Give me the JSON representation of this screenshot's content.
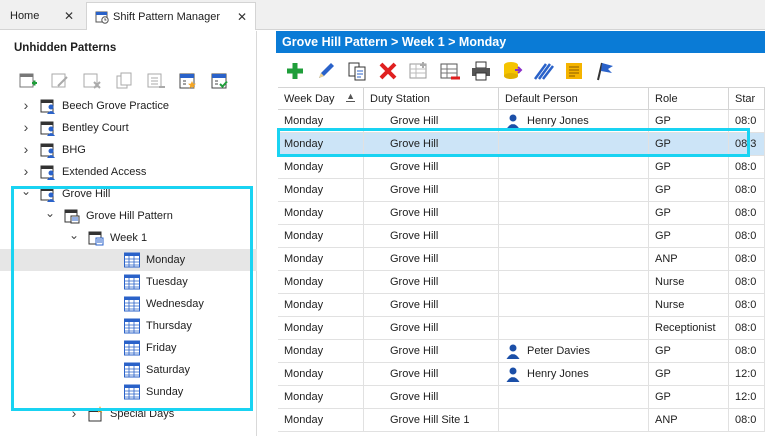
{
  "tabs": [
    {
      "label": "Home",
      "close": "✕"
    },
    {
      "label": "Shift Pattern Manager",
      "close": "✕"
    }
  ],
  "left_panel": {
    "title": "Unhidden Patterns",
    "toolbar_icons": [
      "add-pattern-icon",
      "edit-pattern-icon",
      "delete-pattern-icon",
      "copy-pattern-icon",
      "hide-pattern-icon",
      "calendar-star-icon",
      "calendar-check-icon"
    ],
    "tree": [
      {
        "label": "Beech Grove Practice",
        "level": 0,
        "expander": "›",
        "icon": "practice-icon"
      },
      {
        "label": "Bentley Court",
        "level": 0,
        "expander": "›",
        "icon": "practice-icon"
      },
      {
        "label": "BHG",
        "level": 0,
        "expander": "›",
        "icon": "practice-icon"
      },
      {
        "label": "Extended Access",
        "level": 0,
        "expander": "›",
        "icon": "practice-icon"
      },
      {
        "label": "Grove Hill",
        "level": 0,
        "expander": "⌄",
        "icon": "practice-icon"
      },
      {
        "label": "Grove Hill Pattern",
        "level": 1,
        "expander": "⌄",
        "icon": "pattern-icon"
      },
      {
        "label": "Week 1",
        "level": 2,
        "expander": "⌄",
        "icon": "week-icon"
      },
      {
        "label": "Monday",
        "level": 3,
        "expander": "",
        "icon": "day-icon",
        "selected": true
      },
      {
        "label": "Tuesday",
        "level": 3,
        "expander": "",
        "icon": "day-icon"
      },
      {
        "label": "Wednesday",
        "level": 3,
        "expander": "",
        "icon": "day-icon"
      },
      {
        "label": "Thursday",
        "level": 3,
        "expander": "",
        "icon": "day-icon"
      },
      {
        "label": "Friday",
        "level": 3,
        "expander": "",
        "icon": "day-icon"
      },
      {
        "label": "Saturday",
        "level": 3,
        "expander": "",
        "icon": "day-icon"
      },
      {
        "label": "Sunday",
        "level": 3,
        "expander": "",
        "icon": "day-icon"
      },
      {
        "label": "Special Days",
        "level": 2,
        "expander": "›",
        "icon": "special-days-icon"
      }
    ]
  },
  "right_panel": {
    "breadcrumb": "Grove Hill Pattern > Week 1 > Monday",
    "toolbar_icons": [
      "add-icon",
      "edit-icon",
      "copy-icon",
      "delete-icon",
      "grid-add-icon",
      "grid-remove-icon",
      "print-icon",
      "database-export-icon",
      "bulk-edit-icon",
      "notes-icon",
      "flag-icon"
    ],
    "columns": [
      "Week Day",
      "Duty Station",
      "Default Person",
      "Role",
      "Star"
    ],
    "sort_indicator": "▲",
    "rows": [
      {
        "week_day": "Monday",
        "duty_station": "Grove Hill",
        "person": "Henry Jones",
        "role": "GP",
        "start": "08:0"
      },
      {
        "week_day": "Monday",
        "duty_station": "Grove Hill",
        "person": "",
        "role": "GP",
        "start": "08:3",
        "selected": true
      },
      {
        "week_day": "Monday",
        "duty_station": "Grove Hill",
        "person": "",
        "role": "GP",
        "start": "08:0"
      },
      {
        "week_day": "Monday",
        "duty_station": "Grove Hill",
        "person": "",
        "role": "GP",
        "start": "08:0"
      },
      {
        "week_day": "Monday",
        "duty_station": "Grove Hill",
        "person": "",
        "role": "GP",
        "start": "08:0"
      },
      {
        "week_day": "Monday",
        "duty_station": "Grove Hill",
        "person": "",
        "role": "GP",
        "start": "08:0"
      },
      {
        "week_day": "Monday",
        "duty_station": "Grove Hill",
        "person": "",
        "role": "ANP",
        "start": "08:0"
      },
      {
        "week_day": "Monday",
        "duty_station": "Grove Hill",
        "person": "",
        "role": "Nurse",
        "start": "08:0"
      },
      {
        "week_day": "Monday",
        "duty_station": "Grove Hill",
        "person": "",
        "role": "Nurse",
        "start": "08:0"
      },
      {
        "week_day": "Monday",
        "duty_station": "Grove Hill",
        "person": "",
        "role": "Receptionist",
        "start": "08:0"
      },
      {
        "week_day": "Monday",
        "duty_station": "Grove Hill",
        "person": "Peter Davies",
        "role": "GP",
        "start": "08:0"
      },
      {
        "week_day": "Monday",
        "duty_station": "Grove Hill",
        "person": "Henry Jones",
        "role": "GP",
        "start": "12:0"
      },
      {
        "week_day": "Monday",
        "duty_station": "Grove Hill",
        "person": "",
        "role": "GP",
        "start": "12:0"
      },
      {
        "week_day": "Monday",
        "duty_station": "Grove Hill Site 1",
        "person": "",
        "role": "ANP",
        "start": "08:0"
      }
    ]
  },
  "colors": {
    "accent": "#0a7bd6",
    "highlight": "#19d3f2",
    "selected_row": "#cce4f7",
    "selected_tree": "#e6e6e6"
  }
}
